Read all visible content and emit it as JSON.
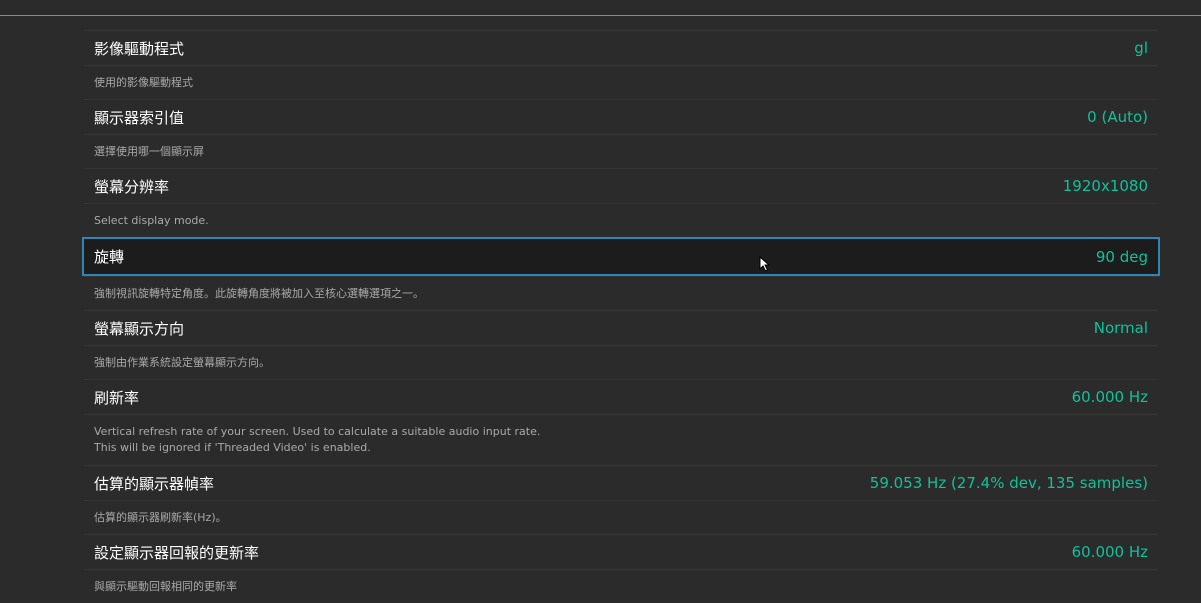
{
  "settings": [
    {
      "label": "影像驅動程式",
      "value": "gl",
      "desc": [
        "使用的影像驅動程式"
      ]
    },
    {
      "label": "顯示器索引值",
      "value": "0 (Auto)",
      "desc": [
        "選擇使用哪一個顯示屏"
      ]
    },
    {
      "label": "螢幕分辨率",
      "value": "1920x1080",
      "desc": [
        "Select display mode."
      ]
    },
    {
      "label": "旋轉",
      "value": "90 deg",
      "desc": [
        "強制視訊旋轉特定角度。此旋轉角度將被加入至核心選轉選項之一。"
      ],
      "selected": true
    },
    {
      "label": "螢幕顯示方向",
      "value": "Normal",
      "desc": [
        "強制由作業系統設定螢幕顯示方向。"
      ]
    },
    {
      "label": "刷新率",
      "value": "60.000 Hz",
      "desc": [
        "Vertical refresh rate of your screen. Used to calculate a suitable audio input rate.",
        "This will be ignored if 'Threaded Video' is enabled."
      ]
    },
    {
      "label": "估算的顯示器幀率",
      "value": "59.053 Hz (27.4% dev, 135 samples)",
      "desc": [
        "估算的顯示器刷新率(Hz)。"
      ]
    },
    {
      "label": "設定顯示器回報的更新率",
      "value": "60.000 Hz",
      "desc": [
        "與顯示驅動回報相同的更新率"
      ]
    }
  ],
  "theme": {
    "accent": "#11c19a",
    "selection_border": "#2f86b5",
    "background": "#2b2b2b"
  },
  "icons": {
    "cursor": "mouse-pointer-icon"
  }
}
